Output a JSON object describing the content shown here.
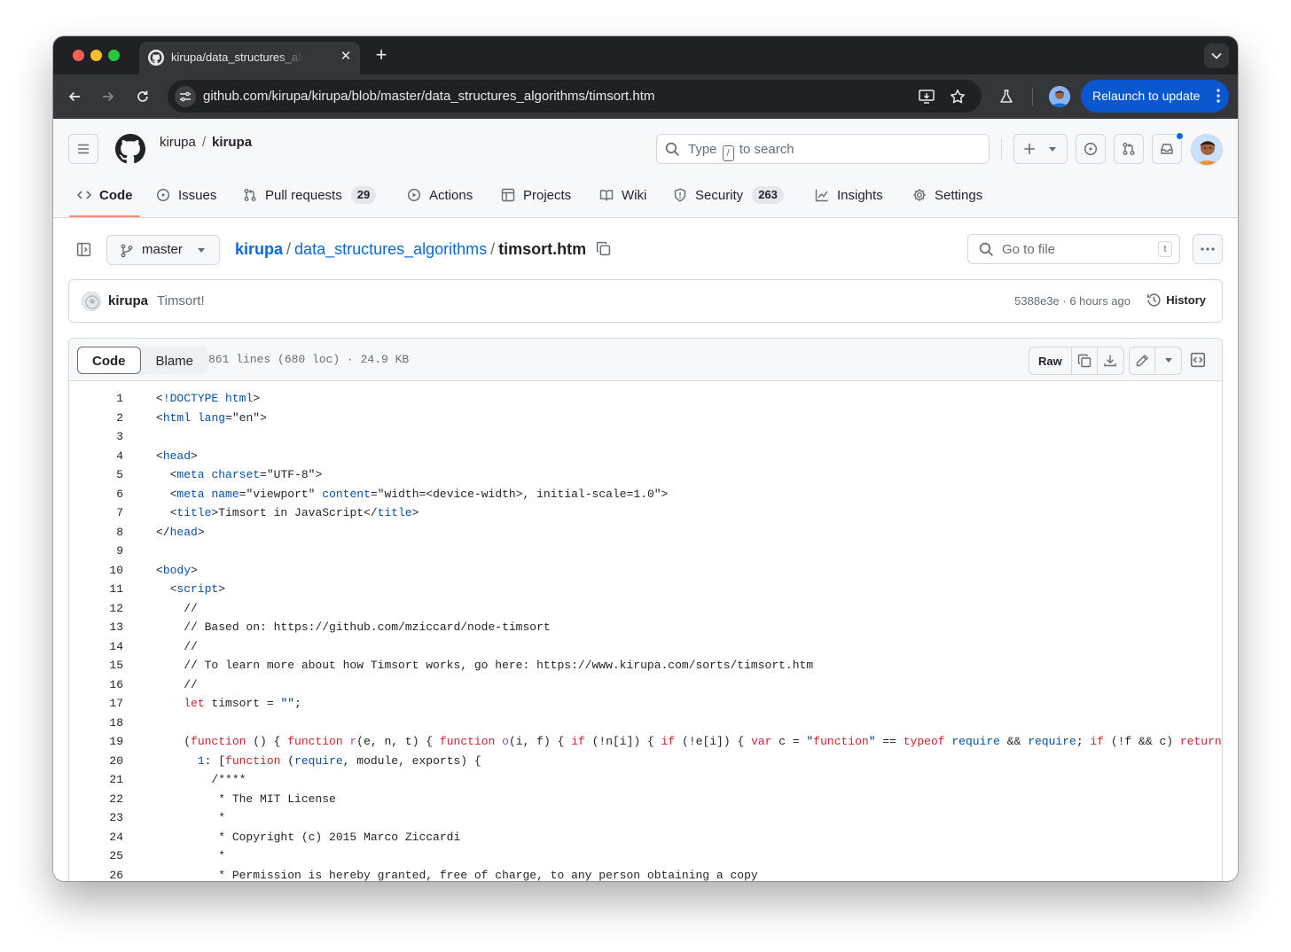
{
  "browser": {
    "tab_title": "kirupa/data_structures_algorithms",
    "url": "github.com/kirupa/kirupa/blob/master/data_structures_algorithms/timsort.htm",
    "relaunch_label": "Relaunch to update"
  },
  "repo": {
    "owner": "kirupa",
    "name": "kirupa",
    "search_prefix": "Type",
    "search_slash": "/",
    "search_suffix": "to search"
  },
  "nav": {
    "code": "Code",
    "issues": "Issues",
    "pull_requests": "Pull requests",
    "pull_requests_count": "29",
    "actions": "Actions",
    "projects": "Projects",
    "wiki": "Wiki",
    "security": "Security",
    "security_count": "263",
    "insights": "Insights",
    "settings": "Settings"
  },
  "path": {
    "branch": "master",
    "root": "kirupa",
    "folder": "data_structures_algorithms",
    "file": "timsort.htm",
    "goto_placeholder": "Go to file",
    "goto_key": "t"
  },
  "commit": {
    "author": "kirupa",
    "message": "Timsort!",
    "meta": "5388e3e · 6 hours ago",
    "history": "History"
  },
  "file": {
    "tab_code": "Code",
    "tab_blame": "Blame",
    "info": "861 lines (680 loc) · 24.9 KB",
    "raw": "Raw"
  },
  "code": [
    {
      "n": "1",
      "t": "<!DOCTYPE html>"
    },
    {
      "n": "2",
      "t": "<html lang=\"en\">"
    },
    {
      "n": "3",
      "t": ""
    },
    {
      "n": "4",
      "t": "<head>"
    },
    {
      "n": "5",
      "t": "  <meta charset=\"UTF-8\">"
    },
    {
      "n": "6",
      "t": "  <meta name=\"viewport\" content=\"width=<device-width>, initial-scale=1.0\">"
    },
    {
      "n": "7",
      "t": "  <title>Timsort in JavaScript</title>"
    },
    {
      "n": "8",
      "t": "</head>"
    },
    {
      "n": "9",
      "t": ""
    },
    {
      "n": "10",
      "t": "<body>"
    },
    {
      "n": "11",
      "t": "  <script>"
    },
    {
      "n": "12",
      "t": "    //"
    },
    {
      "n": "13",
      "t": "    // Based on: https://github.com/mziccard/node-timsort"
    },
    {
      "n": "14",
      "t": "    //"
    },
    {
      "n": "15",
      "t": "    // To learn more about how Timsort works, go here: https://www.kirupa.com/sorts/timsort.htm"
    },
    {
      "n": "16",
      "t": "    //"
    },
    {
      "n": "17",
      "t": "    let timsort = \"\";"
    },
    {
      "n": "18",
      "t": ""
    },
    {
      "n": "19",
      "t": "    (function () { function r(e, n, t) { function o(i, f) { if (!n[i]) { if (!e[i]) { var c = \"function\" == typeof require && require; if (!f && c) return"
    },
    {
      "n": "20",
      "t": "      1: [function (require, module, exports) {"
    },
    {
      "n": "21",
      "t": "        /****"
    },
    {
      "n": "22",
      "t": "         * The MIT License"
    },
    {
      "n": "23",
      "t": "         *"
    },
    {
      "n": "24",
      "t": "         * Copyright (c) 2015 Marco Ziccardi"
    },
    {
      "n": "25",
      "t": "         *"
    },
    {
      "n": "26",
      "t": "         * Permission is hereby granted, free of charge, to any person obtaining a copy"
    }
  ]
}
